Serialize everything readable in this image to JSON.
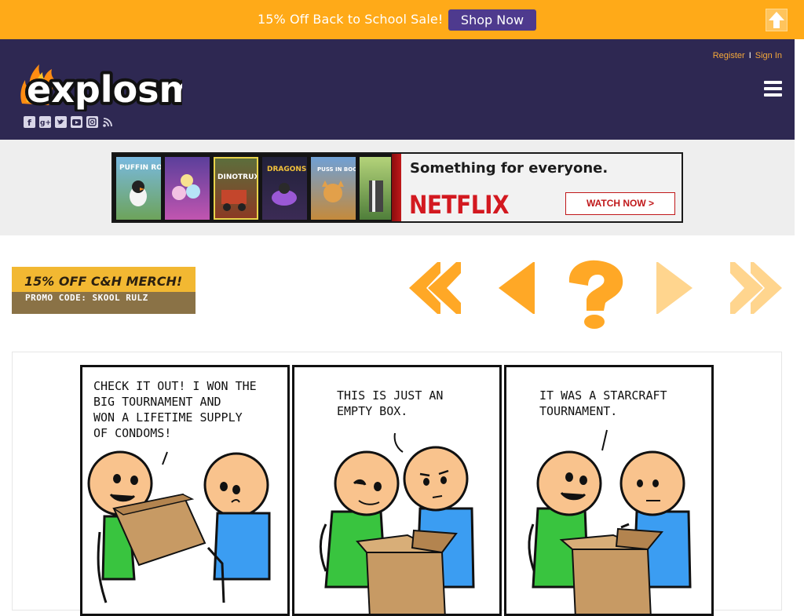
{
  "promo": {
    "text": "15% Off Back to School Sale!",
    "button": "Shop Now"
  },
  "header": {
    "logo_text": "explosm",
    "register": "Register",
    "separator": "I",
    "sign_in": "Sign In",
    "social_icons": [
      "facebook-icon",
      "google-plus-icon",
      "twitter-icon",
      "youtube-icon",
      "instagram-icon",
      "rss-icon"
    ]
  },
  "ad": {
    "headline": "Something for everyone.",
    "brand": "NETFLIX",
    "cta": "WATCH NOW >",
    "posters": [
      "PUFFIN ROCK",
      "",
      "DINOTRUX",
      "DRAGONS",
      "PUSS IN BOOTS",
      ""
    ]
  },
  "merch": {
    "line1": "15% OFF C&H MERCH!",
    "line2": "PROMO CODE: SKOOL RULZ"
  },
  "comic": {
    "panels": [
      {
        "caption": "CHECK IT OUT! I WON THE\nBIG TOURNAMENT AND\nWON A LIFETIME SUPPLY\nOF CONDOMS!"
      },
      {
        "caption": "THIS IS JUST AN\nEMPTY BOX."
      },
      {
        "caption": "IT WAS A STARCRAFT\nTOURNAMENT."
      }
    ]
  },
  "colors": {
    "promo_bg": "#ffaa18",
    "header_bg": "#2e2852",
    "shop_button": "#4e3a8e",
    "nav_arrow": "#ffa826",
    "nav_arrow_disabled": "#ffd58e",
    "netflix_red": "#d31920"
  }
}
